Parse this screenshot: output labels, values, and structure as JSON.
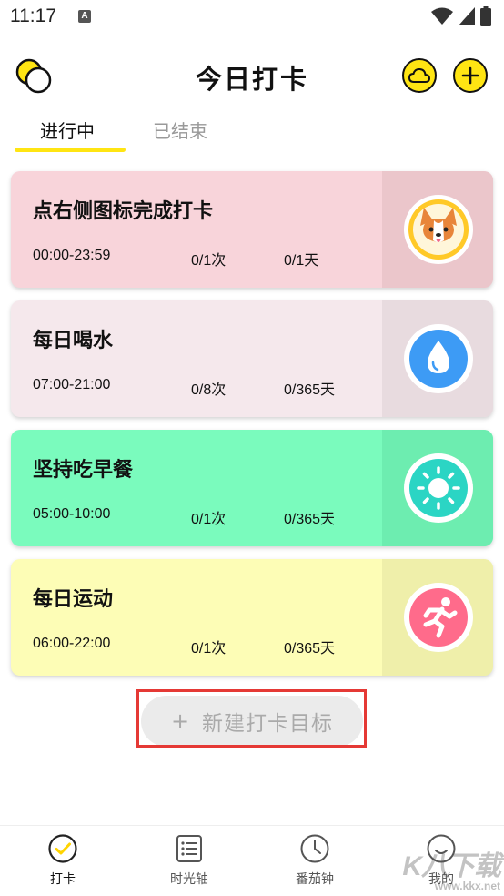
{
  "status": {
    "time": "11:17",
    "notif_icon": "A"
  },
  "header": {
    "title": "今日打卡",
    "left_icon": "theme-circles-icon",
    "cloud_icon": "cloud-icon",
    "add_icon": "plus-icon",
    "accent": "#FFE513"
  },
  "tabs": [
    {
      "label": "进行中",
      "active": true
    },
    {
      "label": "已结束",
      "active": false
    }
  ],
  "cards": [
    {
      "title": "点右侧图标完成打卡",
      "time": "00:00-23:59",
      "count": "0/1次",
      "days": "0/1天",
      "bg": "#F8D4DA",
      "side": "#EBC6CB",
      "icon": "corgi-icon"
    },
    {
      "title": "每日喝水",
      "time": "07:00-21:00",
      "count": "0/8次",
      "days": "0/365天",
      "bg": "#F5E8EC",
      "side": "#E8DBDF",
      "icon": "water-drop-icon"
    },
    {
      "title": "坚持吃早餐",
      "time": "05:00-10:00",
      "count": "0/1次",
      "days": "0/365天",
      "bg": "#7AFBBD",
      "side": "#6DEDB0",
      "icon": "sun-icon"
    },
    {
      "title": "每日运动",
      "time": "06:00-22:00",
      "count": "0/1次",
      "days": "0/365天",
      "bg": "#FDFDB6",
      "side": "#EFEFAA",
      "icon": "running-icon"
    }
  ],
  "new_goal": {
    "plus": "+",
    "label": "新建打卡目标"
  },
  "bottom_nav": [
    {
      "label": "打卡",
      "icon": "checkmark-circle-icon",
      "active": true
    },
    {
      "label": "时光轴",
      "icon": "list-icon",
      "active": false
    },
    {
      "label": "番茄钟",
      "icon": "clock-icon",
      "active": false
    },
    {
      "label": "我的",
      "icon": "profile-icon",
      "active": false
    }
  ],
  "watermark": {
    "main": "K八下载",
    "url": "www.kkx.net"
  }
}
